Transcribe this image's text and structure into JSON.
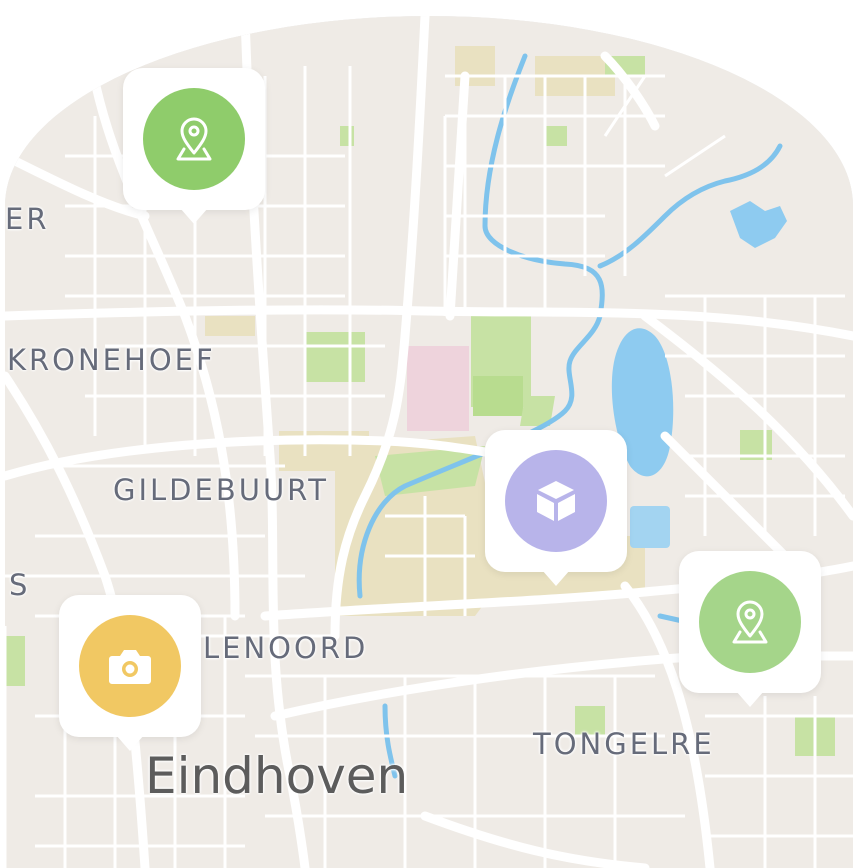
{
  "map": {
    "city_label": "Eindhoven",
    "district_labels": {
      "er": "ER",
      "kronehoef": "KRONEHOEF",
      "gildebuurt": "GILDEBUURT",
      "s": "S",
      "lenoord": "LENOORD",
      "tongelre": "TONGELRE"
    },
    "colors": {
      "land": "#efebe6",
      "road": "#ffffff",
      "water": "#8ecbf0",
      "park": "#c5e0a0",
      "industrial": "#e8dfc0",
      "pink": "#eed3dc"
    }
  },
  "markers": [
    {
      "name": "location-pin-marker-north",
      "icon": "location-pin-icon",
      "color": "#8fcc6b"
    },
    {
      "name": "package-marker",
      "icon": "package-cube-icon",
      "color": "#b8b4ea"
    },
    {
      "name": "location-pin-marker-east",
      "icon": "location-pin-icon",
      "color": "#a5d58a"
    },
    {
      "name": "camera-marker",
      "icon": "camera-icon",
      "color": "#f1c863"
    }
  ]
}
